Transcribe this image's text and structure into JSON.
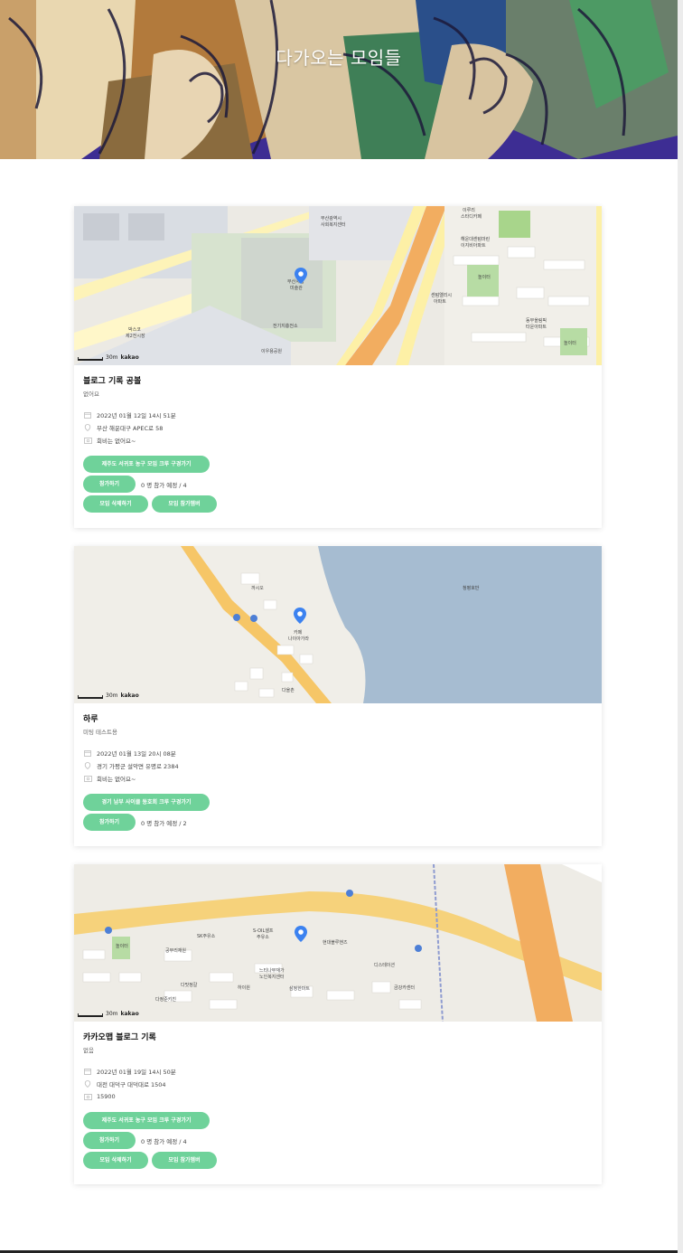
{
  "hero": {
    "title": "다가오는 모임들"
  },
  "map_common": {
    "scale": "30m",
    "logo": "kakao"
  },
  "meetings": [
    {
      "title": "블로그 기록 공볼",
      "description": "없어요",
      "datetime": "2022년 01월 12일 14시 51분",
      "address": "부산 해운대구 APEC로 58",
      "fee": "회비는 없어요~",
      "crew_button": "제주도 서귀포 농구 모임 크루 구경가기",
      "join_button": "참가하기",
      "count": "0 명 참가 예정 / 4",
      "delete_button": "모임 삭제하기",
      "members_button": "모임 참가멤버",
      "map_labels": [
        "부산광역시 사회복지센터",
        "이루리 스타디카페",
        "해운대센텀마린 이지비아파트",
        "센텀엘리시 아파트",
        "동부올림픽 타운아파트",
        "부산시립 미술관",
        "전기지충전소",
        "이우용공원",
        "박스코 제2전시장",
        "놀이터",
        "놀이터"
      ]
    },
    {
      "title": "하루",
      "description": "미팅 테스트용",
      "datetime": "2022년 01월 13일 20시 08분",
      "address": "경기 가평군 설악면 유명로 2384",
      "fee": "회비는 없어요~",
      "crew_button": "경기 남부 사이클 동호회 크루 구경가기",
      "join_button": "참가하기",
      "count": "0 명 참가 예정 / 2",
      "map_labels": [
        "까시오",
        "카페 나이아가라",
        "청평호반",
        "다올촌"
      ]
    },
    {
      "title": "카카오맵 블로그 기록",
      "description": "없음",
      "datetime": "2022년 01월 19일 14시 50분",
      "address": "대전 대덕구 대덕대로 1504",
      "fee": "15900",
      "crew_button": "제주도 서귀포 농구 모임 크루 구경가기",
      "join_button": "참가하기",
      "count": "0 명 참가 예정 / 4",
      "delete_button": "모임 삭제하기",
      "members_button": "모임 참가멤버",
      "map_labels": [
        "SK주유소",
        "S-OIL셀프 주유소",
        "현대블루핸즈",
        "공무리재원",
        "느티나무재가 노인복지센터",
        "디스테이션",
        "다맛정갈",
        "하이원",
        "삼정한마트",
        "금강카센터",
        "다정준키친",
        "놀이터"
      ]
    }
  ]
}
